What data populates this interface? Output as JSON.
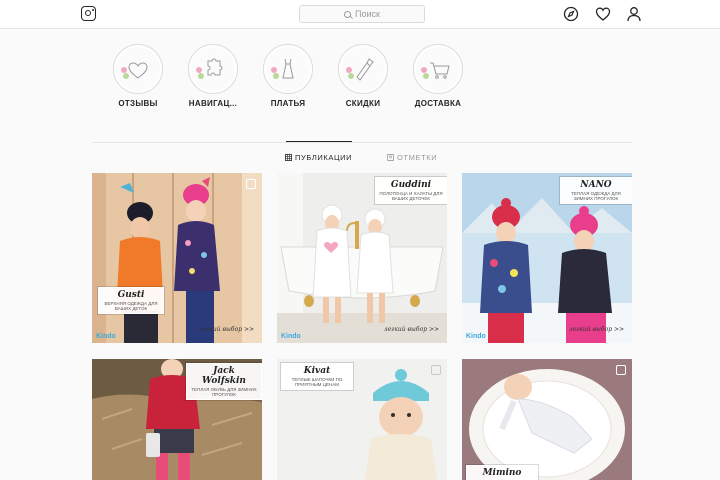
{
  "header": {
    "search_placeholder": "Поиск"
  },
  "highlights": [
    {
      "label": "ОТЗЫВЫ",
      "icon": "heart-icon"
    },
    {
      "label": "НАВИГАЦ...",
      "icon": "puzzle-icon"
    },
    {
      "label": "ПЛАТЬЯ",
      "icon": "dress-icon"
    },
    {
      "label": "СКИДКИ",
      "icon": "bottle-icon"
    },
    {
      "label": "ДОСТАВКА",
      "icon": "cart-icon"
    }
  ],
  "tabs": [
    {
      "label": "ПУБЛИКАЦИИ",
      "active": true
    },
    {
      "label": "ОТМЕТКИ",
      "active": false
    }
  ],
  "posts": [
    {
      "brand": "Gusti",
      "sub": "верхняя одежда для ваших деток",
      "choice": "легкий выбор >>",
      "kindo": "Kindo"
    },
    {
      "brand": "Guddini",
      "sub": "полотенца и халаты для ваших деточек",
      "choice": "легкий выбор >>",
      "kindo": "Kindo"
    },
    {
      "brand": "NANO",
      "sub": "теплая одежда для зимних прогулок",
      "choice": "легкий выбор >>",
      "kindo": "Kindo"
    },
    {
      "brand": "Jack Wolfskin",
      "sub": "теплая обувь для зимних прогулок",
      "choice": "",
      "kindo": ""
    },
    {
      "brand": "Kivat",
      "sub": "теплые шапочки по приятным ценам",
      "choice": "",
      "kindo": ""
    },
    {
      "brand": "Mimino",
      "sub": "",
      "choice": "",
      "kindo": ""
    }
  ],
  "colors": {
    "accent_pink": "#f2a9c0",
    "accent_green": "#b9d99a",
    "text": "#262626",
    "border": "#dbdbdb"
  }
}
